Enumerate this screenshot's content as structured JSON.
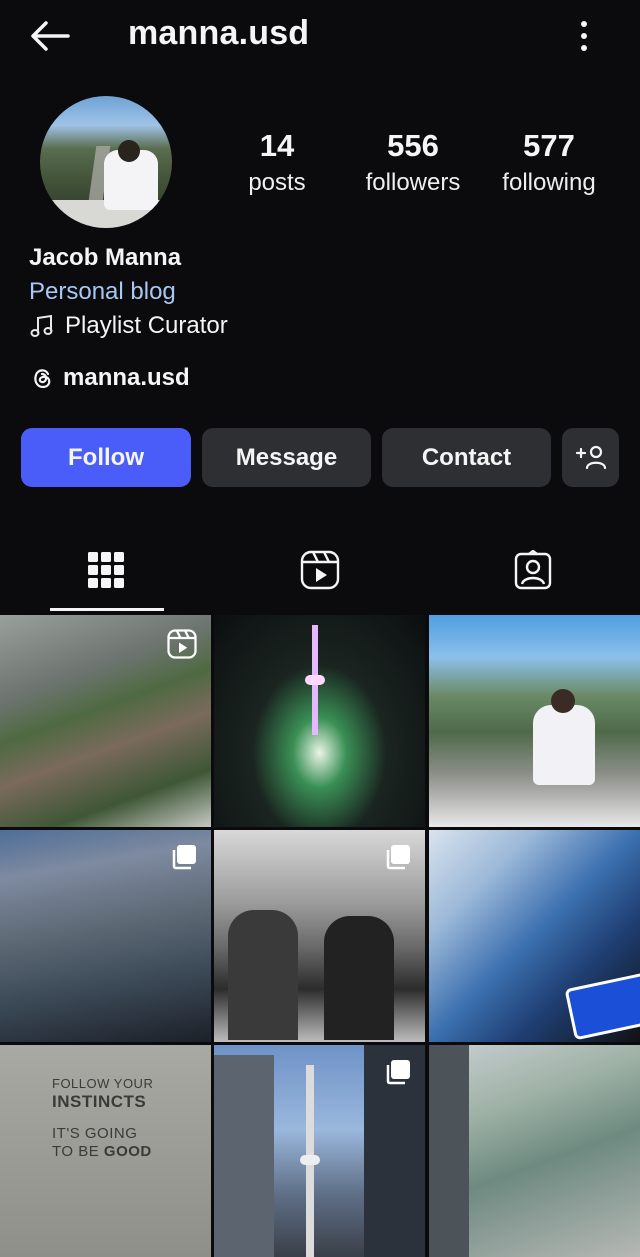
{
  "header": {
    "username": "manna.usd",
    "back_icon": "arrow-left-icon",
    "more_icon": "more-vertical-icon"
  },
  "profile": {
    "avatar_icon": "profile-avatar",
    "stats": {
      "posts_count": "14",
      "posts_label": "posts",
      "followers_count": "556",
      "followers_label": "followers",
      "following_count": "577",
      "following_label": "following"
    },
    "full_name": "Jacob Manna",
    "category": "Personal blog",
    "bio_line": "Playlist Curator",
    "bio_icon": "music-note-icon",
    "threads_handle": "manna.usd",
    "threads_icon": "threads-icon"
  },
  "actions": {
    "follow_label": "Follow",
    "message_label": "Message",
    "contact_label": "Contact",
    "suggest_icon": "add-person-icon"
  },
  "colors": {
    "background": "#0b0b0d",
    "follow_button": "#4a5df9",
    "secondary_button": "#2d2f33",
    "category_link": "#a9c7f2"
  },
  "tabs": [
    {
      "name": "grid",
      "icon": "grid-icon",
      "selected": true
    },
    {
      "name": "reels",
      "icon": "reels-icon",
      "selected": false
    },
    {
      "name": "tagged",
      "icon": "tagged-icon",
      "selected": false
    }
  ],
  "grid": {
    "posts": [
      {
        "id": "post-1",
        "badge": "reel-icon"
      },
      {
        "id": "post-2",
        "badge": ""
      },
      {
        "id": "post-3",
        "badge": ""
      },
      {
        "id": "post-4",
        "badge": "carousel-icon"
      },
      {
        "id": "post-5",
        "badge": "carousel-icon"
      },
      {
        "id": "post-6",
        "badge": ""
      },
      {
        "id": "post-7",
        "badge": ""
      },
      {
        "id": "post-8",
        "badge": "carousel-icon"
      },
      {
        "id": "post-9",
        "badge": ""
      }
    ],
    "quote_post": {
      "line1": "FOLLOW YOUR",
      "line2": "INSTINCTS",
      "line3": "IT'S GOING",
      "line4_prefix": "TO BE ",
      "line4_bold": "GOOD"
    }
  }
}
